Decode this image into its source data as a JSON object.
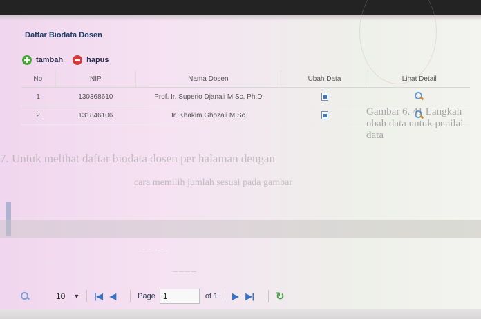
{
  "panel": {
    "title": "Daftar Biodata Dosen"
  },
  "toolbar": {
    "add_label": "tambah",
    "delete_label": "hapus"
  },
  "table": {
    "headers": [
      "No",
      "NIP",
      "Nama Dosen",
      "Ubah Data",
      "Lihat Detail"
    ],
    "rows": [
      {
        "no": "1",
        "nip": "130368610",
        "nama": "Prof. Ir. Superio Djanali M.Sc, Ph.D"
      },
      {
        "no": "2",
        "nip": "131846106",
        "nama": "Ir. Khakim Ghozali M.Sc"
      }
    ]
  },
  "pager": {
    "page_size": "10",
    "page_label": "Page",
    "page_value": "1",
    "of_label": "of 1"
  },
  "background": {
    "caption": "Gambar 6. 41 Langkah ubah data untuk penilai data",
    "line1": "7. Untuk melihat daftar biodata dosen per halaman dengan",
    "line2": "cara memilih jumlah sesuai pada gambar"
  },
  "colors": {
    "header_bar": "#232323",
    "title": "#1f3d6a",
    "add": "#49a13a",
    "delete": "#d33a3a",
    "nav": "#3573c9"
  }
}
